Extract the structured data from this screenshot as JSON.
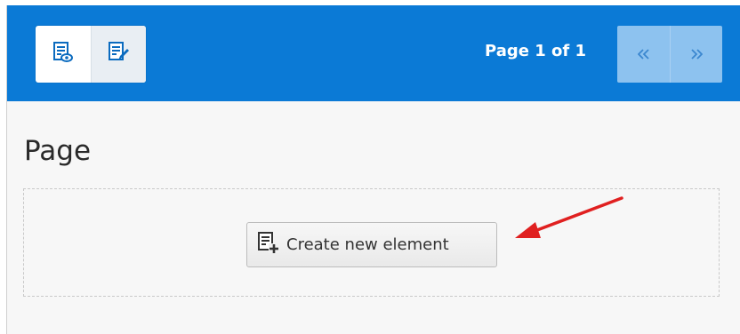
{
  "header": {
    "page_indicator": "Page 1 of 1",
    "view_toggle": {
      "preview_icon": "preview-page-icon",
      "edit_icon": "edit-page-icon",
      "active": "edit"
    },
    "pager": {
      "prev_icon": "double-chevron-left-icon",
      "next_icon": "double-chevron-right-icon"
    },
    "colors": {
      "bar": "#0b7ad6",
      "pager_button": "#8dc2ef"
    }
  },
  "content": {
    "title": "Page",
    "create_button": {
      "icon": "add-content-element-icon",
      "label": "Create new element"
    }
  },
  "annotation": {
    "arrow_icon": "red-arrow-icon",
    "arrow_color": "#e02020"
  }
}
